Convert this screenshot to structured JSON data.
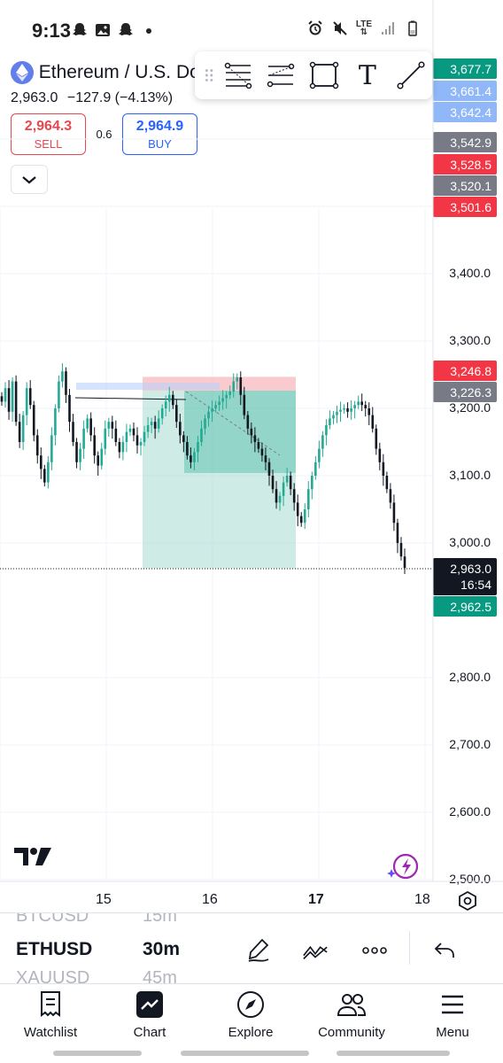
{
  "status_bar": {
    "time": "9:13",
    "network": "LTE",
    "left_icons": [
      "snapchat-icon",
      "gallery-icon",
      "snapchat-icon",
      "dot-icon"
    ],
    "right_icons": [
      "alarm-icon",
      "mute-icon",
      "lte-icon",
      "signal-icon",
      "battery-icon"
    ]
  },
  "header": {
    "symbol_title": "Ethereum / U.S. Do",
    "last_price": "2,963.0",
    "change": "−127.9 (−4.13%)",
    "sell": {
      "price": "2,964.3",
      "label": "SELL"
    },
    "buy": {
      "price": "2,964.9",
      "label": "BUY"
    },
    "spread": "0.6"
  },
  "drawing_toolbar": {
    "tools": [
      "fib-retracement-icon",
      "parallel-channel-icon",
      "rectangle-icon",
      "text-icon",
      "trend-line-icon"
    ],
    "text_tool_glyph": "T"
  },
  "price_scale": {
    "labels": [
      "3,400.0",
      "3,300.0",
      "3,200.0",
      "3,100.0",
      "3,000.0",
      "2,800.0",
      "2,700.0",
      "2,600.0",
      "2,500.0"
    ],
    "badges": [
      {
        "value": "3,677.7",
        "color": "#089981"
      },
      {
        "value": "3,661.4",
        "color": "#90b8f8"
      },
      {
        "value": "3,642.4",
        "color": "#90b8f8"
      },
      {
        "value": "3,542.9",
        "color": "#787b86"
      },
      {
        "value": "3,528.5",
        "color": "#f23645"
      },
      {
        "value": "3,520.1",
        "color": "#787b86"
      },
      {
        "value": "3,501.6",
        "color": "#f23645"
      },
      {
        "value": "3,246.8",
        "color": "#f23645"
      },
      {
        "value": "3,226.3",
        "color": "#787b86"
      },
      {
        "value": "2,962.5",
        "color": "#089981"
      }
    ],
    "current_price": "2,963.0",
    "countdown": "16:54"
  },
  "time_scale": {
    "labels": [
      "15",
      "16",
      "17",
      "18"
    ],
    "bold_label": "17"
  },
  "chart_data": {
    "type": "candlestick",
    "symbol": "ETHUSD",
    "interval": "30m",
    "x_labels": [
      "15",
      "16",
      "17",
      "18"
    ],
    "y_range": [
      2500,
      3450
    ],
    "colors": {
      "up": "#22ab94",
      "down": "#131722",
      "short_position_stop": "#f7b8be",
      "short_position_target": "#9fd8cc"
    },
    "series": [
      {
        "name": "ETHUSD",
        "closes": [
          3210,
          3230,
          3195,
          3240,
          3180,
          3150,
          3190,
          3230,
          3205,
          3160,
          3130,
          3110,
          3090,
          3120,
          3160,
          3200,
          3240,
          3255,
          3220,
          3180,
          3150,
          3120,
          3140,
          3170,
          3185,
          3160,
          3130,
          3115,
          3140,
          3170,
          3180,
          3170,
          3150,
          3135,
          3150,
          3165,
          3170,
          3160,
          3145,
          3150,
          3165,
          3175,
          3180,
          3170,
          3185,
          3200,
          3210,
          3220,
          3205,
          3180,
          3160,
          3150,
          3130,
          3120,
          3135,
          3150,
          3170,
          3185,
          3195,
          3200,
          3205,
          3210,
          3215,
          3220,
          3225,
          3240,
          3246,
          3220,
          3190,
          3170,
          3160,
          3150,
          3140,
          3130,
          3120,
          3100,
          3080,
          3060,
          3070,
          3090,
          3100,
          3080,
          3060,
          3040,
          3030,
          3050,
          3080,
          3100,
          3120,
          3140,
          3160,
          3175,
          3185,
          3190,
          3195,
          3198,
          3200,
          3195,
          3200,
          3205,
          3210,
          3205,
          3200,
          3190,
          3170,
          3140,
          3120,
          3100,
          3080,
          3060,
          3030,
          3000,
          2980,
          2963
        ]
      }
    ],
    "short_position": {
      "entry": 3226.3,
      "stop": 3246.8,
      "target": 2962.5
    }
  },
  "symbol_picker": {
    "prev": {
      "symbol": "BTCUSD",
      "interval": "15m"
    },
    "current": {
      "symbol": "ETHUSD",
      "interval": "30m"
    },
    "next": {
      "symbol": "XAUUSD",
      "interval": "45m"
    }
  },
  "bottom_nav": {
    "items": [
      {
        "label": "Watchlist",
        "icon": "watchlist-icon"
      },
      {
        "label": "Chart",
        "icon": "chart-icon"
      },
      {
        "label": "Explore",
        "icon": "compass-icon"
      },
      {
        "label": "Community",
        "icon": "community-icon"
      },
      {
        "label": "Menu",
        "icon": "menu-icon"
      }
    ]
  }
}
